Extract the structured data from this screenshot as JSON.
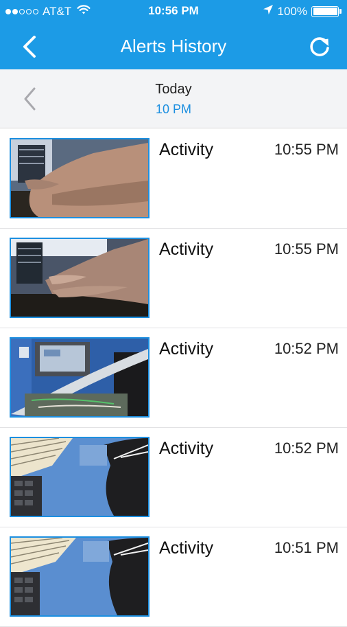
{
  "status_bar": {
    "carrier": "AT&T",
    "time": "10:56 PM",
    "battery": "100%",
    "signal_filled": 2,
    "signal_total": 5,
    "icons": [
      "wifi-icon",
      "location-arrow-icon",
      "battery-icon"
    ]
  },
  "nav": {
    "title": "Alerts History",
    "back_icon": "chevron-left-icon",
    "refresh_icon": "refresh-icon"
  },
  "date_bar": {
    "day": "Today",
    "hour": "10 PM",
    "prev_icon": "chevron-left-icon"
  },
  "alerts": [
    {
      "label": "Activity",
      "time": "10:55 PM"
    },
    {
      "label": "Activity",
      "time": "10:55 PM"
    },
    {
      "label": "Activity",
      "time": "10:52 PM"
    },
    {
      "label": "Activity",
      "time": "10:52 PM"
    },
    {
      "label": "Activity",
      "time": "10:51 PM"
    }
  ],
  "colors": {
    "accent": "#1c9be6",
    "link": "#1c8fe0",
    "date_bar_bg": "#f3f4f6"
  }
}
